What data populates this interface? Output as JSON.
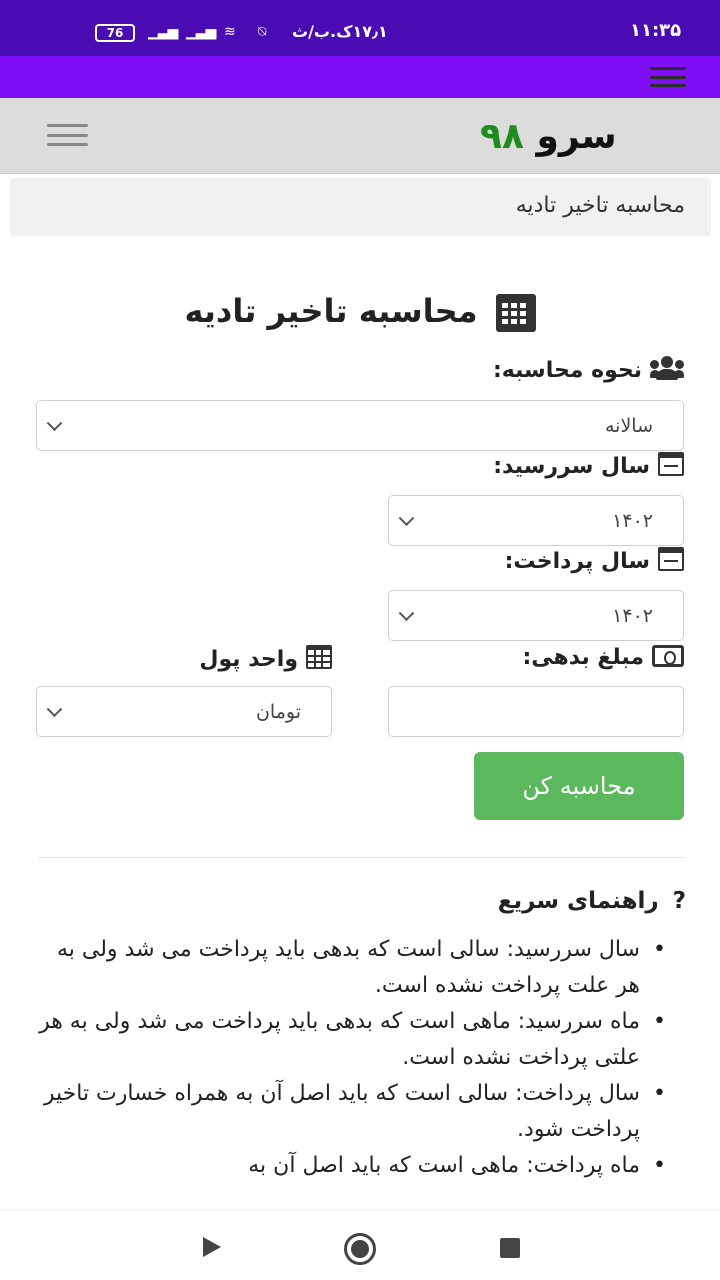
{
  "status_bar": {
    "time": "۱۱:۳۵",
    "battery": "76",
    "secondary_clock": "۱۷٫۱ک.ب/ث"
  },
  "header": {
    "logo_text": "سرو",
    "logo_number": "۹۸"
  },
  "breadcrumb": "محاسبه تاخیر تادیه",
  "page_title": "محاسبه تاخیر تادیه",
  "form": {
    "method_label": "نحوه محاسبه:",
    "method_value": "سالانه",
    "due_year_label": "سال سررسید:",
    "due_year_value": "۱۴۰۲",
    "payment_year_label": "سال پرداخت:",
    "payment_year_value": "۱۴۰۲",
    "debt_amount_label": "مبلغ بدهی:",
    "debt_amount_value": "",
    "currency_label": "واحد پول",
    "currency_value": "تومان",
    "submit_label": "محاسبه کن"
  },
  "help": {
    "title": "راهنمای سریع",
    "items": [
      "سال سررسید: سالی است که بدهی باید پرداخت می شد ولی به هر علت پرداخت نشده است.",
      "ماه سررسید: ماهی است که بدهی باید پرداخت می شد ولی به هر علتی پرداخت نشده است.",
      "سال پرداخت: سالی است که باید اصل آن به همراه خسارت تاخیر پرداخت شود.",
      "ماه پرداخت: ماهی است که باید اصل آن به"
    ]
  },
  "colors": {
    "status_bar": "#4b0bb3",
    "top_nav": "#7f0ef5",
    "logo_number": "#1e8c1e",
    "submit_button": "#5cb85c"
  }
}
